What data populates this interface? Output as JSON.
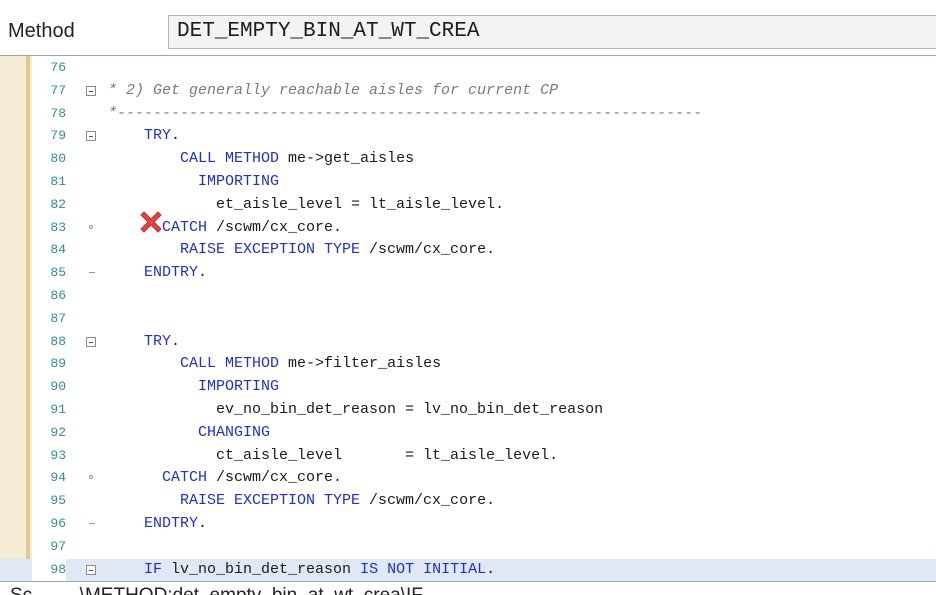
{
  "header": {
    "method_label": "Method",
    "method_name": "DET_EMPTY_BIN_AT_WT_CREA"
  },
  "editor": {
    "current_line": 98,
    "lines": [
      {
        "num": "76",
        "fold": "",
        "segments": []
      },
      {
        "num": "77",
        "fold": "box",
        "segments": [
          {
            "cls": "cm",
            "text": "* 2) Get generally reachable aisles for current CP"
          }
        ]
      },
      {
        "num": "78",
        "fold": "",
        "segments": [
          {
            "cls": "cm",
            "text": "*-----------------------------------------------------------------"
          }
        ]
      },
      {
        "num": "79",
        "fold": "box",
        "segments": [
          {
            "cls": "",
            "text": "    "
          },
          {
            "cls": "kw",
            "text": "TRY"
          },
          {
            "cls": "",
            "text": "."
          }
        ]
      },
      {
        "num": "80",
        "fold": "",
        "segments": [
          {
            "cls": "",
            "text": "        "
          },
          {
            "cls": "kw",
            "text": "CALL METHOD"
          },
          {
            "cls": "",
            "text": " me->get_aisles"
          }
        ]
      },
      {
        "num": "81",
        "fold": "",
        "segments": [
          {
            "cls": "",
            "text": "          "
          },
          {
            "cls": "kw",
            "text": "IMPORTING"
          }
        ]
      },
      {
        "num": "82",
        "fold": "",
        "segments": [
          {
            "cls": "",
            "text": "            et_aisle_level = lt_aisle_level."
          }
        ]
      },
      {
        "num": "83",
        "fold": "dot",
        "segments": [
          {
            "cls": "",
            "text": "      "
          },
          {
            "cls": "kw",
            "text": "CATCH"
          },
          {
            "cls": "",
            "text": " /scwm/cx_core."
          }
        ]
      },
      {
        "num": "84",
        "fold": "",
        "segments": [
          {
            "cls": "",
            "text": "        "
          },
          {
            "cls": "kw",
            "text": "RAISE EXCEPTION TYPE"
          },
          {
            "cls": "",
            "text": " /scwm/cx_core."
          }
        ]
      },
      {
        "num": "85",
        "fold": "dash",
        "segments": [
          {
            "cls": "",
            "text": "    "
          },
          {
            "cls": "kw",
            "text": "ENDTRY"
          },
          {
            "cls": "",
            "text": "."
          }
        ]
      },
      {
        "num": "86",
        "fold": "",
        "segments": []
      },
      {
        "num": "87",
        "fold": "",
        "segments": []
      },
      {
        "num": "88",
        "fold": "box",
        "segments": [
          {
            "cls": "",
            "text": "    "
          },
          {
            "cls": "kw",
            "text": "TRY"
          },
          {
            "cls": "",
            "text": "."
          }
        ]
      },
      {
        "num": "89",
        "fold": "",
        "segments": [
          {
            "cls": "",
            "text": "        "
          },
          {
            "cls": "kw",
            "text": "CALL METHOD"
          },
          {
            "cls": "",
            "text": " me->filter_aisles"
          }
        ]
      },
      {
        "num": "90",
        "fold": "",
        "segments": [
          {
            "cls": "",
            "text": "          "
          },
          {
            "cls": "kw",
            "text": "IMPORTING"
          }
        ]
      },
      {
        "num": "91",
        "fold": "",
        "segments": [
          {
            "cls": "",
            "text": "            ev_no_bin_det_reason = lv_no_bin_det_reason"
          }
        ]
      },
      {
        "num": "92",
        "fold": "",
        "segments": [
          {
            "cls": "",
            "text": "          "
          },
          {
            "cls": "kw",
            "text": "CHANGING"
          }
        ]
      },
      {
        "num": "93",
        "fold": "",
        "segments": [
          {
            "cls": "",
            "text": "            ct_aisle_level       = lt_aisle_level."
          }
        ]
      },
      {
        "num": "94",
        "fold": "dot",
        "segments": [
          {
            "cls": "",
            "text": "      "
          },
          {
            "cls": "kw",
            "text": "CATCH"
          },
          {
            "cls": "",
            "text": " /scwm/cx_core."
          }
        ]
      },
      {
        "num": "95",
        "fold": "",
        "segments": [
          {
            "cls": "",
            "text": "        "
          },
          {
            "cls": "kw",
            "text": "RAISE EXCEPTION TYPE"
          },
          {
            "cls": "",
            "text": " /scwm/cx_core."
          }
        ]
      },
      {
        "num": "96",
        "fold": "dash",
        "segments": [
          {
            "cls": "",
            "text": "    "
          },
          {
            "cls": "kw",
            "text": "ENDTRY"
          },
          {
            "cls": "",
            "text": "."
          }
        ]
      },
      {
        "num": "97",
        "fold": "",
        "segments": []
      },
      {
        "num": "98",
        "fold": "box",
        "segments": [
          {
            "cls": "",
            "text": "    "
          },
          {
            "cls": "kw",
            "text": "IF"
          },
          {
            "cls": "",
            "text": " lv_no_bin_det_reason "
          },
          {
            "cls": "kw",
            "text": "IS NOT INITIAL"
          },
          {
            "cls": "",
            "text": "."
          }
        ]
      }
    ]
  },
  "marker": {
    "icon": "red-x-icon",
    "color": "#e0443e"
  },
  "status": {
    "text": "Sc         \\METHOD:det_empty_bin_at_wt_crea\\IF"
  }
}
